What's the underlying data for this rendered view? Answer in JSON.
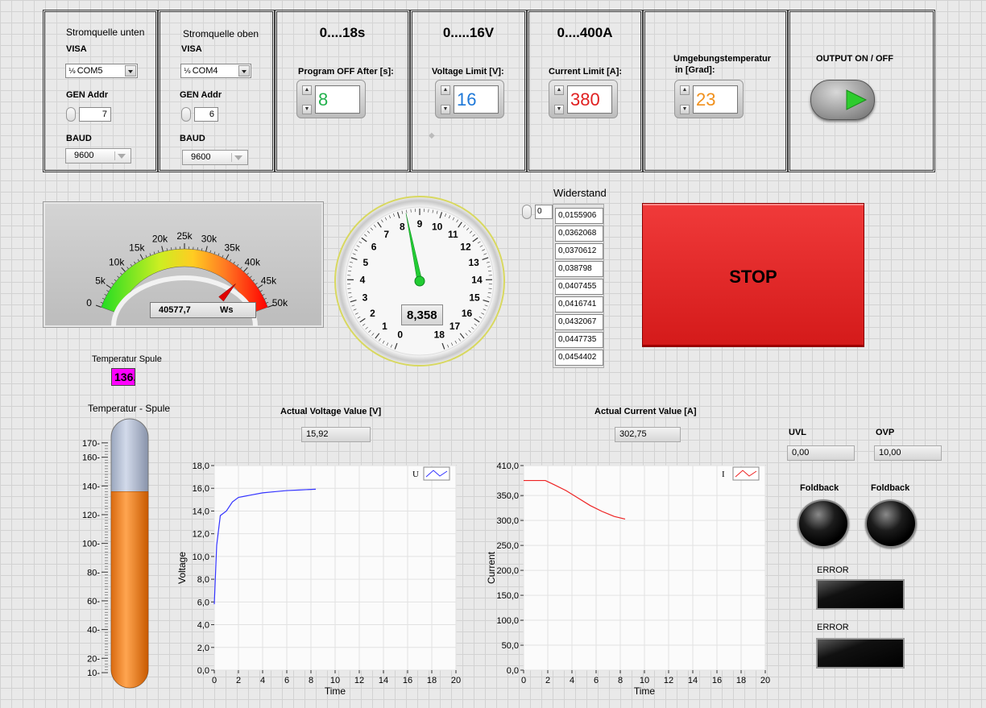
{
  "source_low": {
    "title": "Stromquelle unten",
    "visa_label": "VISA",
    "visa_icon": "io-icon",
    "visa_value": "COM5",
    "gen_addr_label": "GEN Addr",
    "gen_addr_value": "7",
    "baud_label": "BAUD",
    "baud_value": "9600"
  },
  "source_high": {
    "title": "Stromquelle oben",
    "visa_label": "VISA",
    "visa_icon": "io-icon",
    "visa_value": "COM4",
    "gen_addr_label": "GEN Addr",
    "gen_addr_value": "6",
    "baud_label": "BAUD",
    "baud_value": "9600"
  },
  "program_off": {
    "range": "0....18s",
    "label": "Program OFF After [s]:",
    "value": "8",
    "color": "#22b14c"
  },
  "voltage_limit": {
    "range": "0.....16V",
    "label": "Voltage Limit [V]:",
    "value": "16",
    "color": "#1e78d8"
  },
  "current_limit": {
    "range": "0....400A",
    "label": "Current Limit [A]:",
    "value": "380",
    "color": "#e02020"
  },
  "ambient": {
    "label_line1": "Umgebungstemperatur",
    "label_line2": "in [Grad]:",
    "value": "23",
    "color": "#f0901c"
  },
  "output": {
    "label": "OUTPUT ON / OFF",
    "state": "on"
  },
  "energy_meter": {
    "ticks": [
      "0",
      "5k",
      "10k",
      "15k",
      "20k",
      "25k",
      "30k",
      "35k",
      "40k",
      "45k",
      "50k"
    ],
    "min": 0,
    "max": 50000,
    "value": 40577.7,
    "display": "40577,7",
    "unit": "Ws"
  },
  "time_gauge": {
    "ticks": [
      "0",
      "1",
      "2",
      "3",
      "4",
      "5",
      "6",
      "7",
      "8",
      "9",
      "10",
      "11",
      "12",
      "13",
      "14",
      "15",
      "16",
      "17",
      "18"
    ],
    "min": 0,
    "max": 18,
    "value": 8.358,
    "display": "8,358"
  },
  "widerstand": {
    "title": "Widerstand",
    "index": "0",
    "values": [
      "0,0155906",
      "0,0362068",
      "0,0370612",
      "0,038798",
      "0,0407455",
      "0,0416741",
      "0,0432067",
      "0,0447735",
      "0,0454402"
    ]
  },
  "stop": {
    "label": "STOP",
    "color": "#e02020"
  },
  "coil_temp": {
    "label": "Temperatur Spule",
    "value": "136,1",
    "color": "#ff00ff"
  },
  "thermometer": {
    "title": "Temperatur - Spule",
    "ticks": [
      "10",
      "20",
      "40",
      "60",
      "80",
      "100",
      "120",
      "140",
      "160",
      "170"
    ],
    "min": 5,
    "max": 180,
    "value": 136.1,
    "fill_color": "#f28a30"
  },
  "voltage_chart": {
    "title": "Actual Voltage Value [V]",
    "display": "15,92",
    "legend": "U",
    "color": "#3333ff"
  },
  "current_chart": {
    "title": "Actual Current Value [A]",
    "display": "302,75",
    "legend": "I",
    "color": "#ee2222"
  },
  "uvl": {
    "label": "UVL",
    "value": "0,00"
  },
  "ovp": {
    "label": "OVP",
    "value": "10,00"
  },
  "foldback": {
    "label1": "Foldback",
    "label2": "Foldback"
  },
  "errors": {
    "label1": "ERROR",
    "label2": "ERROR"
  },
  "chart_data": [
    {
      "type": "line",
      "title": "",
      "xlabel": "Time",
      "ylabel": "Voltage",
      "xlim": [
        0,
        20
      ],
      "ylim": [
        0,
        18
      ],
      "x_ticks": [
        "0",
        "2",
        "4",
        "6",
        "8",
        "10",
        "12",
        "14",
        "16",
        "18",
        "20"
      ],
      "y_ticks": [
        "0,0",
        "2,0",
        "4,0",
        "6,0",
        "8,0",
        "10,0",
        "12,0",
        "14,0",
        "16,0",
        "18,0"
      ],
      "series": [
        {
          "name": "U",
          "x": [
            0,
            0.2,
            0.5,
            1.0,
            1.5,
            2.0,
            2.5,
            3.0,
            4.0,
            5.0,
            6.0,
            7.0,
            8.4
          ],
          "y": [
            5.8,
            11.0,
            13.6,
            14.0,
            14.8,
            15.2,
            15.3,
            15.4,
            15.6,
            15.7,
            15.8,
            15.85,
            15.92
          ]
        }
      ],
      "grid": true,
      "legend": "top-right"
    },
    {
      "type": "line",
      "title": "",
      "xlabel": "Time",
      "ylabel": "Current",
      "xlim": [
        0,
        20
      ],
      "ylim": [
        0,
        410
      ],
      "x_ticks": [
        "0",
        "2",
        "4",
        "6",
        "8",
        "10",
        "12",
        "14",
        "16",
        "18",
        "20"
      ],
      "y_ticks": [
        "0,0",
        "50,0",
        "100,0",
        "150,0",
        "200,0",
        "250,0",
        "300,0",
        "350,0",
        "410,0"
      ],
      "series": [
        {
          "name": "I",
          "x": [
            0,
            1.8,
            2.5,
            3.5,
            4.5,
            5.5,
            6.5,
            7.5,
            8.4
          ],
          "y": [
            380,
            380,
            372,
            360,
            345,
            330,
            318,
            308,
            302.75
          ]
        }
      ],
      "grid": true,
      "legend": "top-right"
    }
  ]
}
